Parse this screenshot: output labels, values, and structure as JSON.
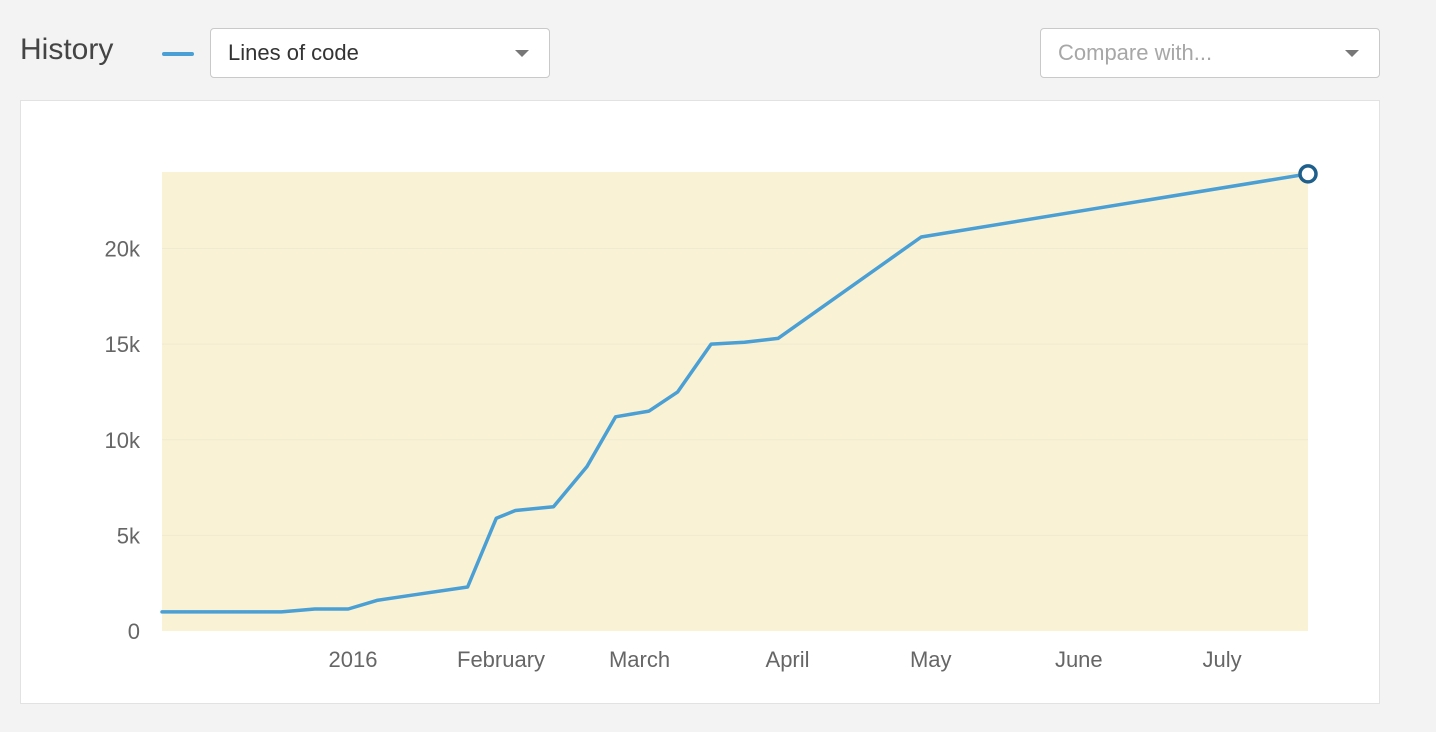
{
  "header": {
    "title": "History",
    "metric_select": {
      "value": "Lines of code"
    },
    "compare_select": {
      "placeholder": "Compare with..."
    }
  },
  "colors": {
    "series_line": "#4a9fd5",
    "highlight_band": "#faf2d4",
    "endpoint_stroke": "#1f5f8b",
    "gridline": "#f0ead2"
  },
  "chart_data": {
    "type": "line",
    "title": "",
    "xlabel": "",
    "ylabel": "",
    "ylim": [
      0,
      24000
    ],
    "grid": true,
    "legend": "top-left",
    "y_ticks": [
      {
        "label": "0",
        "value": 0
      },
      {
        "label": "5k",
        "value": 5000
      },
      {
        "label": "10k",
        "value": 10000
      },
      {
        "label": "15k",
        "value": 15000
      },
      {
        "label": "20k",
        "value": 20000
      }
    ],
    "x_ticks": [
      {
        "label": "2016",
        "date": "2016-01-01"
      },
      {
        "label": "February",
        "date": "2016-02-01"
      },
      {
        "label": "March",
        "date": "2016-03-01"
      },
      {
        "label": "April",
        "date": "2016-04-01"
      },
      {
        "label": "May",
        "date": "2016-05-01"
      },
      {
        "label": "June",
        "date": "2016-06-01"
      },
      {
        "label": "July",
        "date": "2016-07-01"
      }
    ],
    "xlim": [
      "2015-11-22",
      "2016-07-19"
    ],
    "series": [
      {
        "name": "Lines of code",
        "points": [
          {
            "date": "2015-11-22",
            "value": 1000
          },
          {
            "date": "2015-12-17",
            "value": 1000
          },
          {
            "date": "2015-12-24",
            "value": 1150
          },
          {
            "date": "2015-12-31",
            "value": 1150
          },
          {
            "date": "2016-01-06",
            "value": 1600
          },
          {
            "date": "2016-01-14",
            "value": 1900
          },
          {
            "date": "2016-01-25",
            "value": 2300
          },
          {
            "date": "2016-01-31",
            "value": 5900
          },
          {
            "date": "2016-02-04",
            "value": 6300
          },
          {
            "date": "2016-02-12",
            "value": 6500
          },
          {
            "date": "2016-02-19",
            "value": 8600
          },
          {
            "date": "2016-02-25",
            "value": 11200
          },
          {
            "date": "2016-03-03",
            "value": 11500
          },
          {
            "date": "2016-03-09",
            "value": 12500
          },
          {
            "date": "2016-03-16",
            "value": 15000
          },
          {
            "date": "2016-03-23",
            "value": 15100
          },
          {
            "date": "2016-03-30",
            "value": 15300
          },
          {
            "date": "2016-04-29",
            "value": 20600
          },
          {
            "date": "2016-07-19",
            "value": 23900
          }
        ]
      }
    ]
  }
}
